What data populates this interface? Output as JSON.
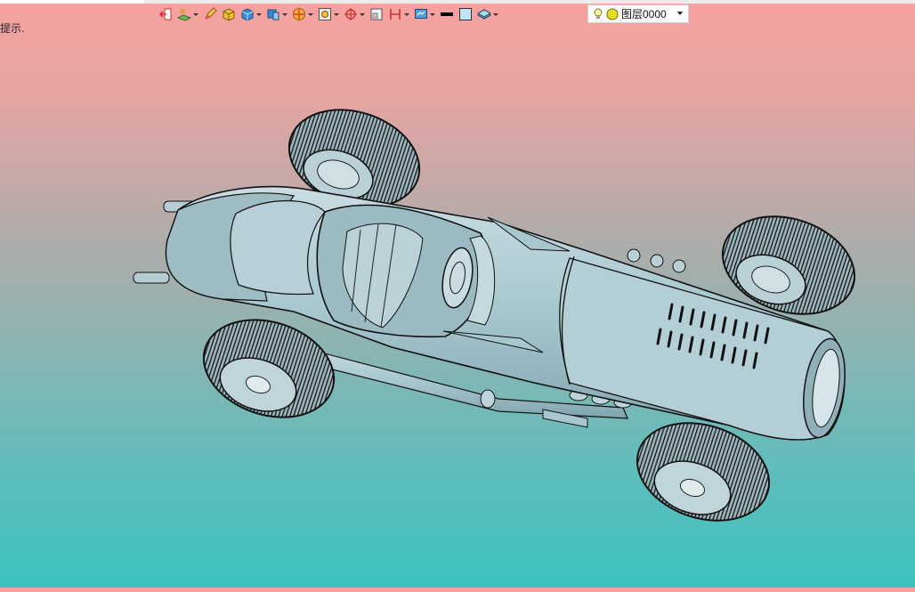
{
  "status": {
    "hint_text": "提示."
  },
  "toolbar": {
    "buttons": [
      {
        "icon": "exit-sketch-icon",
        "dropdown": false
      },
      {
        "icon": "layer-tools-icon",
        "dropdown": true
      },
      {
        "icon": "pencil-icon",
        "dropdown": false
      },
      {
        "icon": "solid-box-icon",
        "dropdown": false
      },
      {
        "icon": "shaded-cube-icon",
        "dropdown": true
      },
      {
        "icon": "view-orient-icon",
        "dropdown": true
      },
      {
        "icon": "color-wheel-icon",
        "dropdown": true
      },
      {
        "icon": "zoom-fit-icon",
        "dropdown": true
      },
      {
        "icon": "crosshair-icon",
        "dropdown": true
      },
      {
        "icon": "frame-icon",
        "dropdown": false
      },
      {
        "icon": "measure-icon",
        "dropdown": true
      },
      {
        "icon": "display-mode-icon",
        "dropdown": true
      },
      {
        "icon": "line-color-icon",
        "dropdown": false
      },
      {
        "icon": "fill-color-icon",
        "dropdown": false
      },
      {
        "icon": "material-icon",
        "dropdown": true
      }
    ],
    "layer": {
      "name": "图层0000"
    }
  },
  "colors": {
    "bg_top": "#f8a1a0",
    "bg_bottom": "#3cc2c0",
    "model_body": "#a7c6ce",
    "model_edge": "#1c2a30"
  }
}
